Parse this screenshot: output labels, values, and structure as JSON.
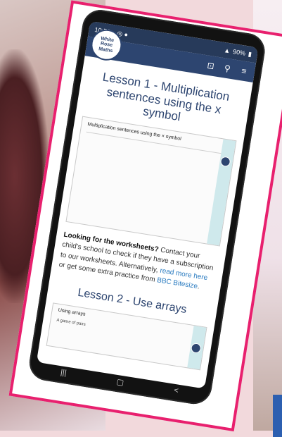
{
  "status_bar": {
    "time": "10:58",
    "battery": "90%"
  },
  "logo": {
    "line1": "White",
    "line2": "Rose",
    "line3": "Maths"
  },
  "lesson1": {
    "title": "Lesson 1 - Multiplication sentences using the x symbol",
    "sheet_title": "Multiplication sentences using the × symbol"
  },
  "worksheets_info": {
    "bold": "Looking for the worksheets?",
    "text1": " Contact your child's school to check if they have a subscription to our worksheets. Alternatively, ",
    "link1": "read more here",
    "text2": " or get some extra practice from ",
    "link2": "BBC Bitesize",
    "text3": "."
  },
  "lesson2": {
    "title": "Lesson 2 - Use arrays",
    "sheet_title": "Using arrays",
    "sheet_sub": "A game of pairs"
  },
  "icons": [
    "logo",
    "shop-icon",
    "search-icon",
    "menu-icon",
    "nav-recent-icon",
    "nav-home-icon",
    "nav-back-icon"
  ],
  "colors": {
    "card_border": "#e8206e",
    "app_bar": "#2d4570",
    "link": "#2a7bc0"
  }
}
